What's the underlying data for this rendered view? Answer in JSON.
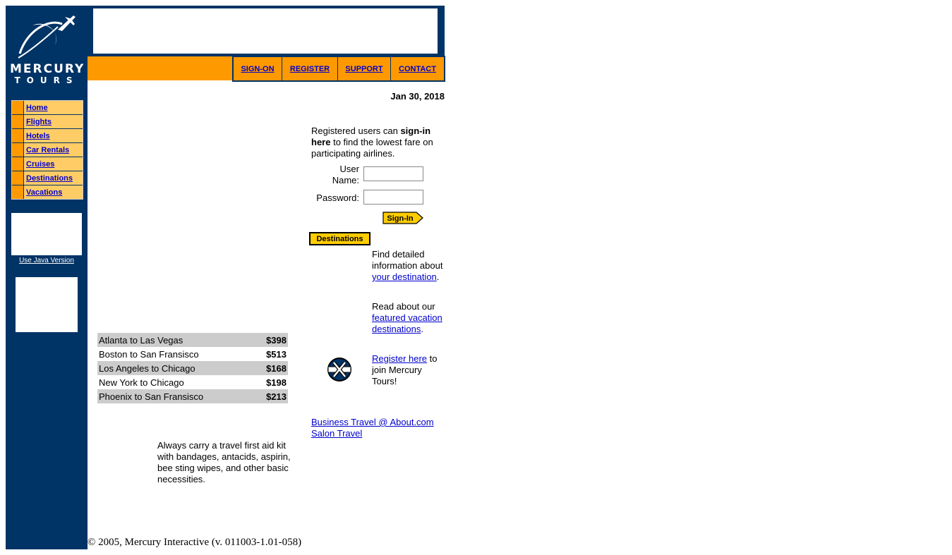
{
  "brand": {
    "line1": "MERCURY",
    "line2": "TOURS"
  },
  "top_nav": [
    {
      "label": "SIGN-ON"
    },
    {
      "label": "REGISTER"
    },
    {
      "label": "SUPPORT"
    },
    {
      "label": "CONTACT"
    }
  ],
  "side_nav": [
    {
      "label": "Home"
    },
    {
      "label": "Flights"
    },
    {
      "label": "Hotels"
    },
    {
      "label": "Car Rentals"
    },
    {
      "label": "Cruises"
    },
    {
      "label": "Destinations"
    },
    {
      "label": "Vacations"
    }
  ],
  "java_link": "Use Java Version",
  "date": "Jan 30, 2018",
  "signin": {
    "intro_pre": "Registered users can ",
    "intro_bold": "sign-in here",
    "intro_post": " to find the lowest fare on participating airlines.",
    "username_label": "User Name:",
    "password_label": "Password:",
    "username_value": "",
    "password_value": "",
    "button_label": "Sign-In"
  },
  "destinations": {
    "button_label": "Destinations",
    "text_pre": "Find detailed information about ",
    "link": "your destination",
    "text_post": "."
  },
  "vacation": {
    "text_pre": "Read about our ",
    "link": "featured vacation destinations",
    "text_post": "."
  },
  "register": {
    "link": "Register here",
    "text_post": " to join Mercury Tours!"
  },
  "fares": [
    {
      "route": "Atlanta to Las Vegas",
      "price": "$398"
    },
    {
      "route": "Boston to San Fransisco",
      "price": "$513"
    },
    {
      "route": "Los Angeles to Chicago",
      "price": "$168"
    },
    {
      "route": "New York to Chicago",
      "price": "$198"
    },
    {
      "route": "Phoenix to San Fransisco",
      "price": "$213"
    }
  ],
  "tip": "Always carry a travel first aid kit with bandages, antacids, aspirin, bee sting wipes, and other basic necessities.",
  "external_links": [
    "Business Travel @ About.com",
    "Salon Travel"
  ],
  "footer": "© 2005, Mercury Interactive (v. 011003-1.01-058)",
  "colors": {
    "navy": "#003366",
    "orange": "#ff9900",
    "light_orange": "#ffcc66",
    "link": "#0000cc",
    "fare_row": "#cccccc",
    "button_yellow": "#ffcc00"
  }
}
